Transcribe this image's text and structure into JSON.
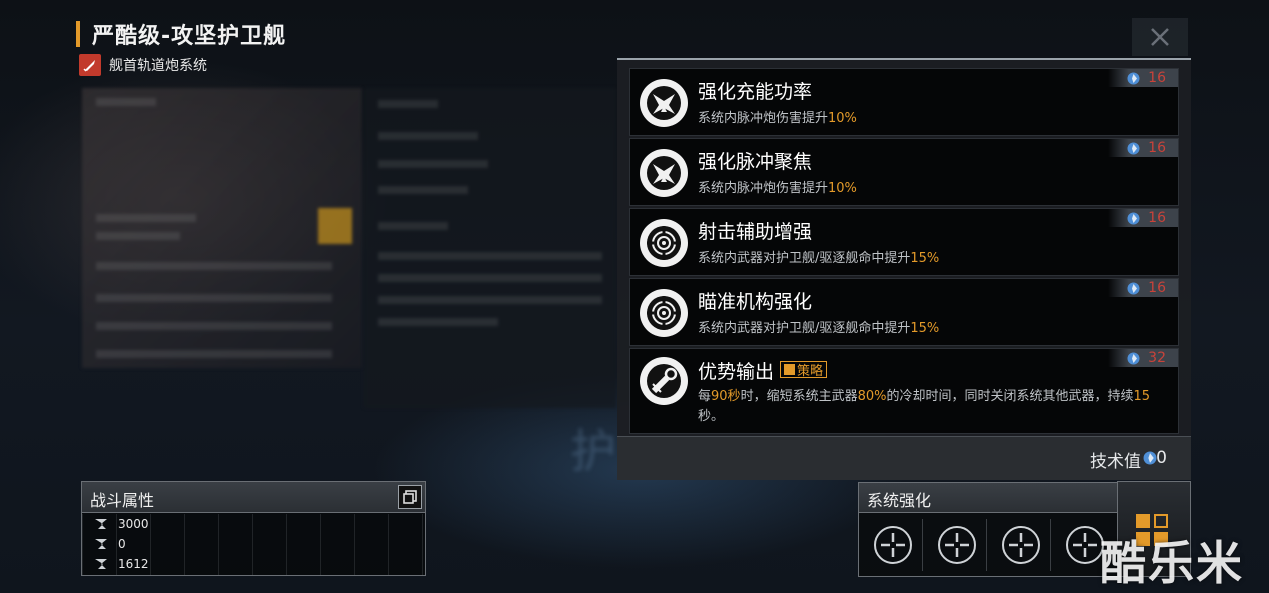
{
  "header": {
    "title": "严酷级-攻坚护卫舰",
    "subtitle": "舰首轨道炮系统",
    "subtitle_icon": "missile-icon",
    "close_icon": "close-icon"
  },
  "upgrades": [
    {
      "name": "强化充能功率",
      "desc_prefix": "系统内脉冲炮伤害提升",
      "desc_value": "10%",
      "cost": "16",
      "icon": "burst-icon"
    },
    {
      "name": "强化脉冲聚焦",
      "desc_prefix": "系统内脉冲炮伤害提升",
      "desc_value": "10%",
      "cost": "16",
      "icon": "burst-icon"
    },
    {
      "name": "射击辅助增强",
      "desc_prefix": "系统内武器对护卫舰/驱逐舰命中提升",
      "desc_value": "15%",
      "cost": "16",
      "icon": "target-icon"
    },
    {
      "name": "瞄准机构强化",
      "desc_prefix": "系统内武器对护卫舰/驱逐舰命中提升",
      "desc_value": "15%",
      "cost": "16",
      "icon": "target-icon"
    },
    {
      "name": "优势输出",
      "tag": "策略",
      "cost": "32",
      "icon": "cannon-icon",
      "desc_parts": [
        "每",
        "90秒",
        "时，缩短系统主武器",
        "80%",
        "的冷却时间，同时关闭系统其他武器，持续",
        "15",
        "秒。"
      ]
    }
  ],
  "footer": {
    "tech_label": "技术值",
    "tech_value": "0"
  },
  "combat_stats": {
    "title": "战斗属性",
    "rows": [
      {
        "value": "3000"
      },
      {
        "value": "0"
      },
      {
        "value": "1612"
      }
    ]
  },
  "system_enhance": {
    "title": "系统强化",
    "slot_count": 4
  },
  "watermark": "酷乐米",
  "colors": {
    "accent": "#e39a2a",
    "cost": "#c9433a",
    "gem": "#4f8fd6"
  }
}
